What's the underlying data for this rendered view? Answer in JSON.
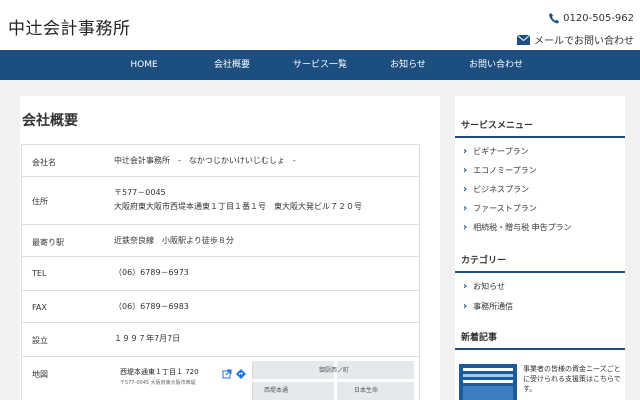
{
  "header": {
    "logo": "中辻会計事務所",
    "phone": "0120-505-962",
    "mail": "メールでお問い合わせ"
  },
  "nav": [
    "HOME",
    "会社概要",
    "サービス一覧",
    "お知らせ",
    "お問い合わせ"
  ],
  "main": {
    "title": "会社概要",
    "rows": [
      {
        "label": "会社名",
        "value": "中辻会計事務所　-　なかつじかいけいじむしょ　-"
      },
      {
        "label": "住所",
        "value": "〒577－0045",
        "value2": "大阪府東大阪市西堤本通東１丁目１番１号　東大阪大発ビル７２０号"
      },
      {
        "label": "最寄り駅",
        "value": "近鉄奈良線　小阪駅より徒歩８分"
      },
      {
        "label": "TEL",
        "value": "（06）6789－6973"
      },
      {
        "label": "FAX",
        "value": "（06）6789－6983"
      },
      {
        "label": "設立",
        "value": "１９９７年7月7日"
      },
      {
        "label": "地図",
        "value": ""
      }
    ],
    "map": {
      "card_title": "西堤本通東１丁目１ 720",
      "card_addr": "〒577-0045 大阪府東大阪市西堤",
      "label1": "御厨西ノ町",
      "label2": "西堤本通",
      "label3": "日本生命"
    }
  },
  "sidebar": {
    "service_heading": "サービスメニュー",
    "services": [
      "ビギナープラン",
      "エコノミープラン",
      "ビジネスプラン",
      "ファーストプラン",
      "相続税・贈与税 申告プラン"
    ],
    "category_heading": "カテゴリー",
    "categories": [
      "お知らせ",
      "事務所通信"
    ],
    "news_heading": "新着記事",
    "news_text": "事業者の皆様の資金ニーズごとに受けられる支援策はこちらです。"
  },
  "colors": {
    "primary": "#1c4e80"
  }
}
